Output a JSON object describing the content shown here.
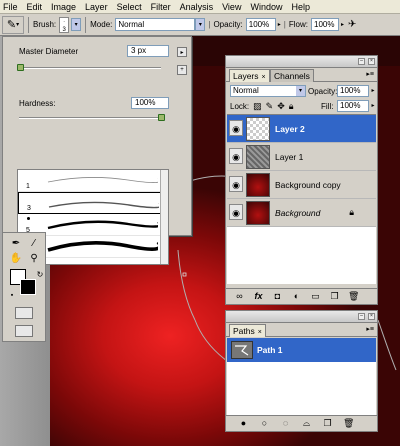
{
  "menu": [
    "File",
    "Edit",
    "Image",
    "Layer",
    "Select",
    "Filter",
    "Analysis",
    "View",
    "Window",
    "Help"
  ],
  "options": {
    "brush_label": "Brush:",
    "brush_size": "3",
    "mode_label": "Mode:",
    "mode_value": "Normal",
    "opacity_label": "Opacity:",
    "opacity_value": "100%",
    "flow_label": "Flow:",
    "flow_value": "100%"
  },
  "brush_picker": {
    "master_label": "Master Diameter",
    "master_value": "3 px",
    "hardness_label": "Hardness:",
    "hardness_value": "100%",
    "hardness_level": 1.0,
    "diameter_level": 0.01,
    "brush_sizes": [
      "1",
      "3",
      "5",
      "9"
    ]
  },
  "layers_panel": {
    "tabs": [
      "Layers",
      "Channels"
    ],
    "blend_mode": "Normal",
    "opacity_label": "Opacity:",
    "opacity_value": "100%",
    "lock_label": "Lock:",
    "fill_label": "Fill:",
    "fill_value": "100%",
    "layers": [
      {
        "name": "Layer 2",
        "selected": true
      },
      {
        "name": "Layer 1",
        "selected": false
      },
      {
        "name": "Background copy",
        "selected": false
      },
      {
        "name": "Background",
        "selected": false,
        "locked": true
      }
    ]
  },
  "paths_panel": {
    "tabs": [
      "Paths"
    ],
    "paths": [
      {
        "name": "Path 1",
        "selected": true
      }
    ]
  },
  "colors": {
    "selection": "#3166c8",
    "canvas_red": "#c41414",
    "panel": "#d4d0c8"
  }
}
